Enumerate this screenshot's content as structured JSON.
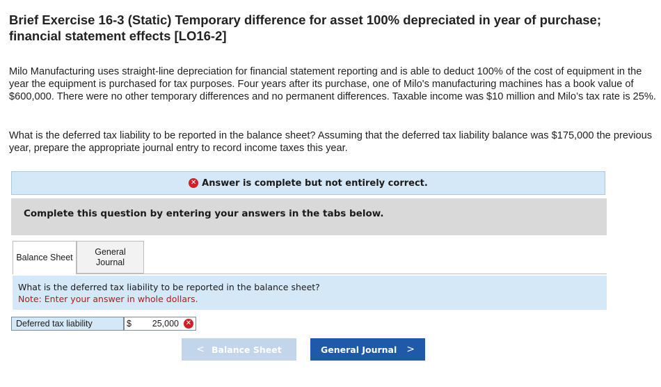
{
  "exercise": {
    "title": "Brief Exercise 16-3 (Static) Temporary difference for asset 100% depreciated in year of purchase; financial statement effects [LO16-2]",
    "paragraph1": "Milo Manufacturing uses straight-line depreciation for financial statement reporting and is able to deduct 100% of the cost of equipment in the year the equipment is purchased for tax purposes. Four years after its purchase, one of Milo's manufacturing machines has a book value of $600,000. There were no other temporary differences and no permanent differences. Taxable income was $10 million and Milo’s tax rate is 25%.",
    "paragraph2": "What is the deferred tax liability to be reported in the balance sheet? Assuming that the deferred tax liability balance was $175,000 the previous year, prepare the appropriate journal entry to record income taxes this year."
  },
  "alert": {
    "icon": "x-circle-icon",
    "text": "Answer is complete but not entirely correct.",
    "color": "#d0202a"
  },
  "instructions": "Complete this question by entering your answers in the tabs below.",
  "tabs": [
    {
      "label": "Balance Sheet",
      "active": true
    },
    {
      "label": "General Journal",
      "active": false
    }
  ],
  "question": {
    "text": "What is the deferred tax liability to be reported in the balance sheet?",
    "note": "Note: Enter your answer in whole dollars."
  },
  "answer_row": {
    "label": "Deferred tax liability",
    "currency": "$",
    "value": "25,000",
    "status_icon": "x-circle-icon"
  },
  "nav": {
    "prev_label": "Balance Sheet",
    "next_label": "General Journal",
    "prev_chevron": "<",
    "next_chevron": ">"
  },
  "colors": {
    "accent": "#1f5aa8",
    "info_background": "#d5e8f7",
    "note_red": "#b5171f"
  }
}
